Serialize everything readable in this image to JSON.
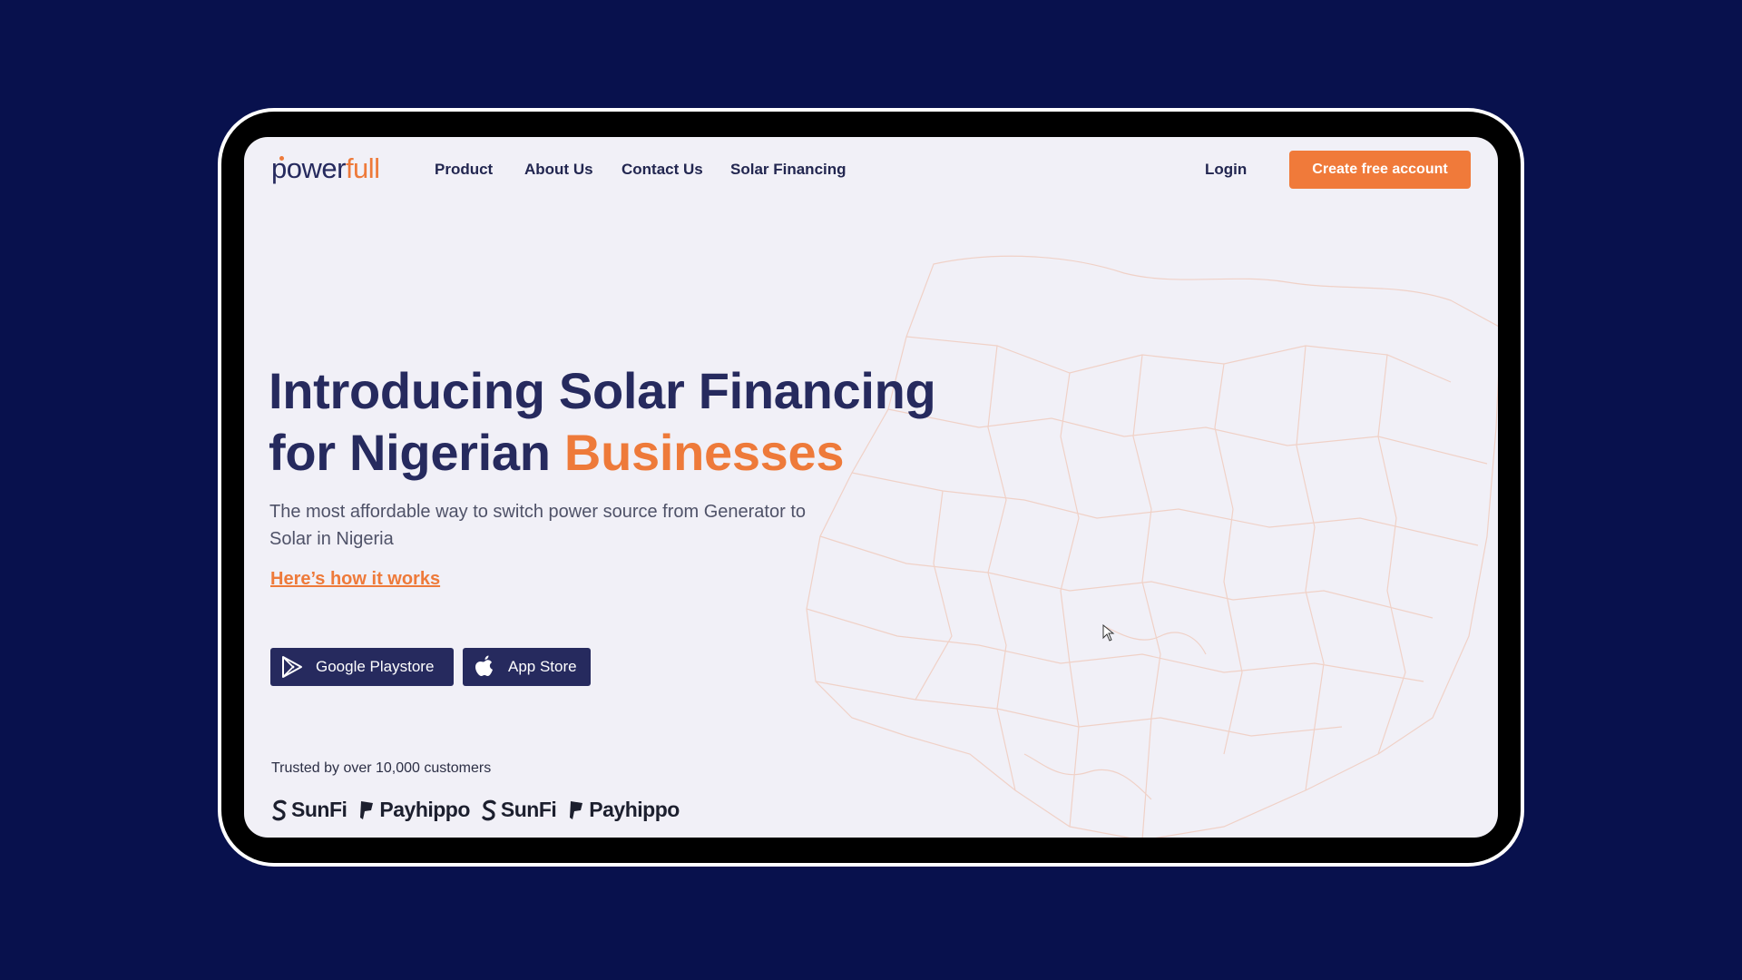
{
  "brand": {
    "logo_part1": "power",
    "logo_part2": "full"
  },
  "nav": {
    "items": [
      {
        "label": "Product"
      },
      {
        "label": "About Us"
      },
      {
        "label": "Contact Us"
      },
      {
        "label": "Solar Financing"
      }
    ],
    "login": "Login",
    "cta": "Create free account"
  },
  "hero": {
    "headline_line1": "Introducing Solar Financing",
    "headline_line2_prefix": "for Nigerian ",
    "headline_line2_accent": "Businesses",
    "subtitle": "The most affordable way to switch power source from Generator to Solar in Nigeria",
    "how_link": "Here’s how it works"
  },
  "stores": {
    "google": "Google Playstore",
    "apple": "App Store"
  },
  "trust": {
    "text": "Trusted by over 10,000 customers",
    "partners": [
      "SunFi",
      "Payhippo",
      "SunFi",
      "Payhippo"
    ]
  },
  "colors": {
    "background": "#08114d",
    "primary_navy": "#262a5e",
    "accent_orange": "#ee7a3a",
    "screen_bg": "#f1f0f7"
  }
}
